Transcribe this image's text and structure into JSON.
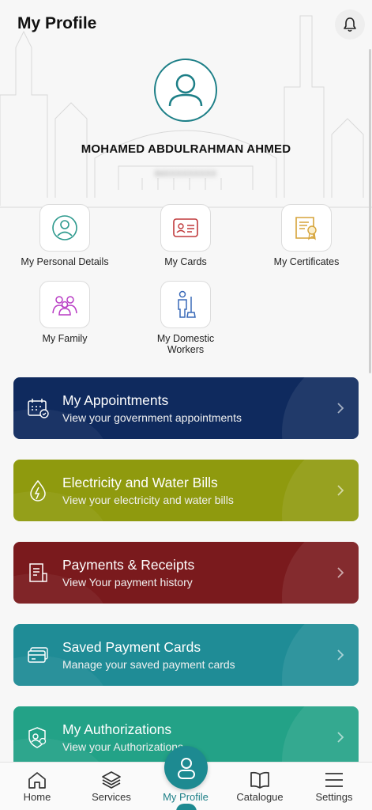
{
  "header": {
    "title": "My Profile",
    "notification_icon": "bell-icon"
  },
  "profile": {
    "avatar_icon": "user-avatar-icon",
    "name": "MOHAMED ABDULRAHMAN AHMED",
    "id_masked": "84XXXXXXXXX"
  },
  "quick_links": [
    {
      "label": "My Personal Details",
      "icon": "person-circle-icon"
    },
    {
      "label": "My Cards",
      "icon": "id-card-icon"
    },
    {
      "label": "My Certificates",
      "icon": "certificate-icon"
    },
    {
      "label": "My Family",
      "icon": "family-icon"
    },
    {
      "label": "My Domestic Workers",
      "icon": "domestic-worker-icon"
    }
  ],
  "cards": [
    {
      "title": "My Appointments",
      "subtitle": "View your government appointments",
      "color": "#0f2a5e",
      "icon": "calendar-check-icon"
    },
    {
      "title": "Electricity and Water Bills",
      "subtitle": "View your electricity and water bills",
      "color": "#8f9a0e",
      "icon": "water-electricity-icon"
    },
    {
      "title": "Payments & Receipts",
      "subtitle": "View Your payment history",
      "color": "#7a1a1d",
      "icon": "receipt-icon"
    },
    {
      "title": "Saved Payment Cards",
      "subtitle": "Manage your saved payment cards",
      "color": "#1f8c96",
      "icon": "credit-card-icon"
    },
    {
      "title": "My Authorizations",
      "subtitle": "View your Authorizations",
      "color": "#23a287",
      "icon": "shield-icon"
    }
  ],
  "bottom_nav": [
    {
      "label": "Home",
      "icon": "home-icon"
    },
    {
      "label": "Services",
      "icon": "layers-icon"
    },
    {
      "label": "My Profile",
      "icon": "profile-icon",
      "active": true
    },
    {
      "label": "Catalogue",
      "icon": "book-icon"
    },
    {
      "label": "Settings",
      "icon": "menu-icon"
    }
  ],
  "colors": {
    "accent": "#1d8a91",
    "active_label": "#1d7f87"
  }
}
